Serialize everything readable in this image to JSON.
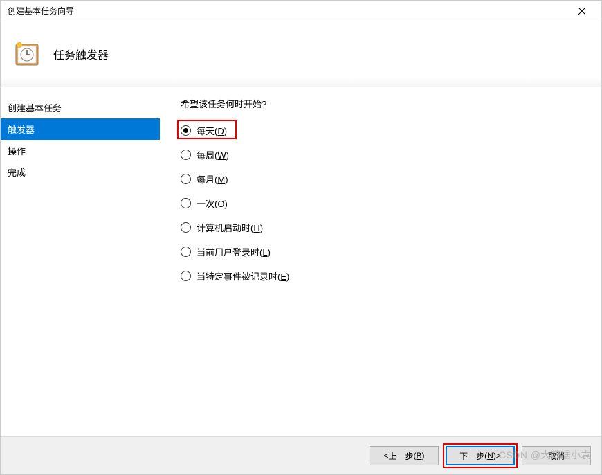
{
  "window": {
    "title": "创建基本任务向导"
  },
  "header": {
    "title": "任务触发器"
  },
  "sidebar": {
    "items": [
      {
        "label": "创建基本任务",
        "selected": false
      },
      {
        "label": "触发器",
        "selected": true
      },
      {
        "label": "操作",
        "selected": false
      },
      {
        "label": "完成",
        "selected": false
      }
    ]
  },
  "main": {
    "question": "希望该任务何时开始?",
    "options": [
      {
        "label": "每天",
        "hotkey": "D",
        "checked": true
      },
      {
        "label": "每周",
        "hotkey": "W",
        "checked": false
      },
      {
        "label": "每月",
        "hotkey": "M",
        "checked": false
      },
      {
        "label": "一次",
        "hotkey": "O",
        "checked": false
      },
      {
        "label": "计算机启动时",
        "hotkey": "H",
        "checked": false
      },
      {
        "label": "当前用户登录时",
        "hotkey": "L",
        "checked": false
      },
      {
        "label": "当特定事件被记录时",
        "hotkey": "E",
        "checked": false
      }
    ]
  },
  "footer": {
    "back": {
      "label": "上一步",
      "hotkey": "B",
      "prefix": "< "
    },
    "next": {
      "label": "下一步",
      "hotkey": "N",
      "suffix": " >"
    },
    "cancel": {
      "label": "取消"
    }
  },
  "watermark": "CSDN @大数据小袁",
  "highlights": {
    "daily_option": true,
    "next_button": true
  }
}
